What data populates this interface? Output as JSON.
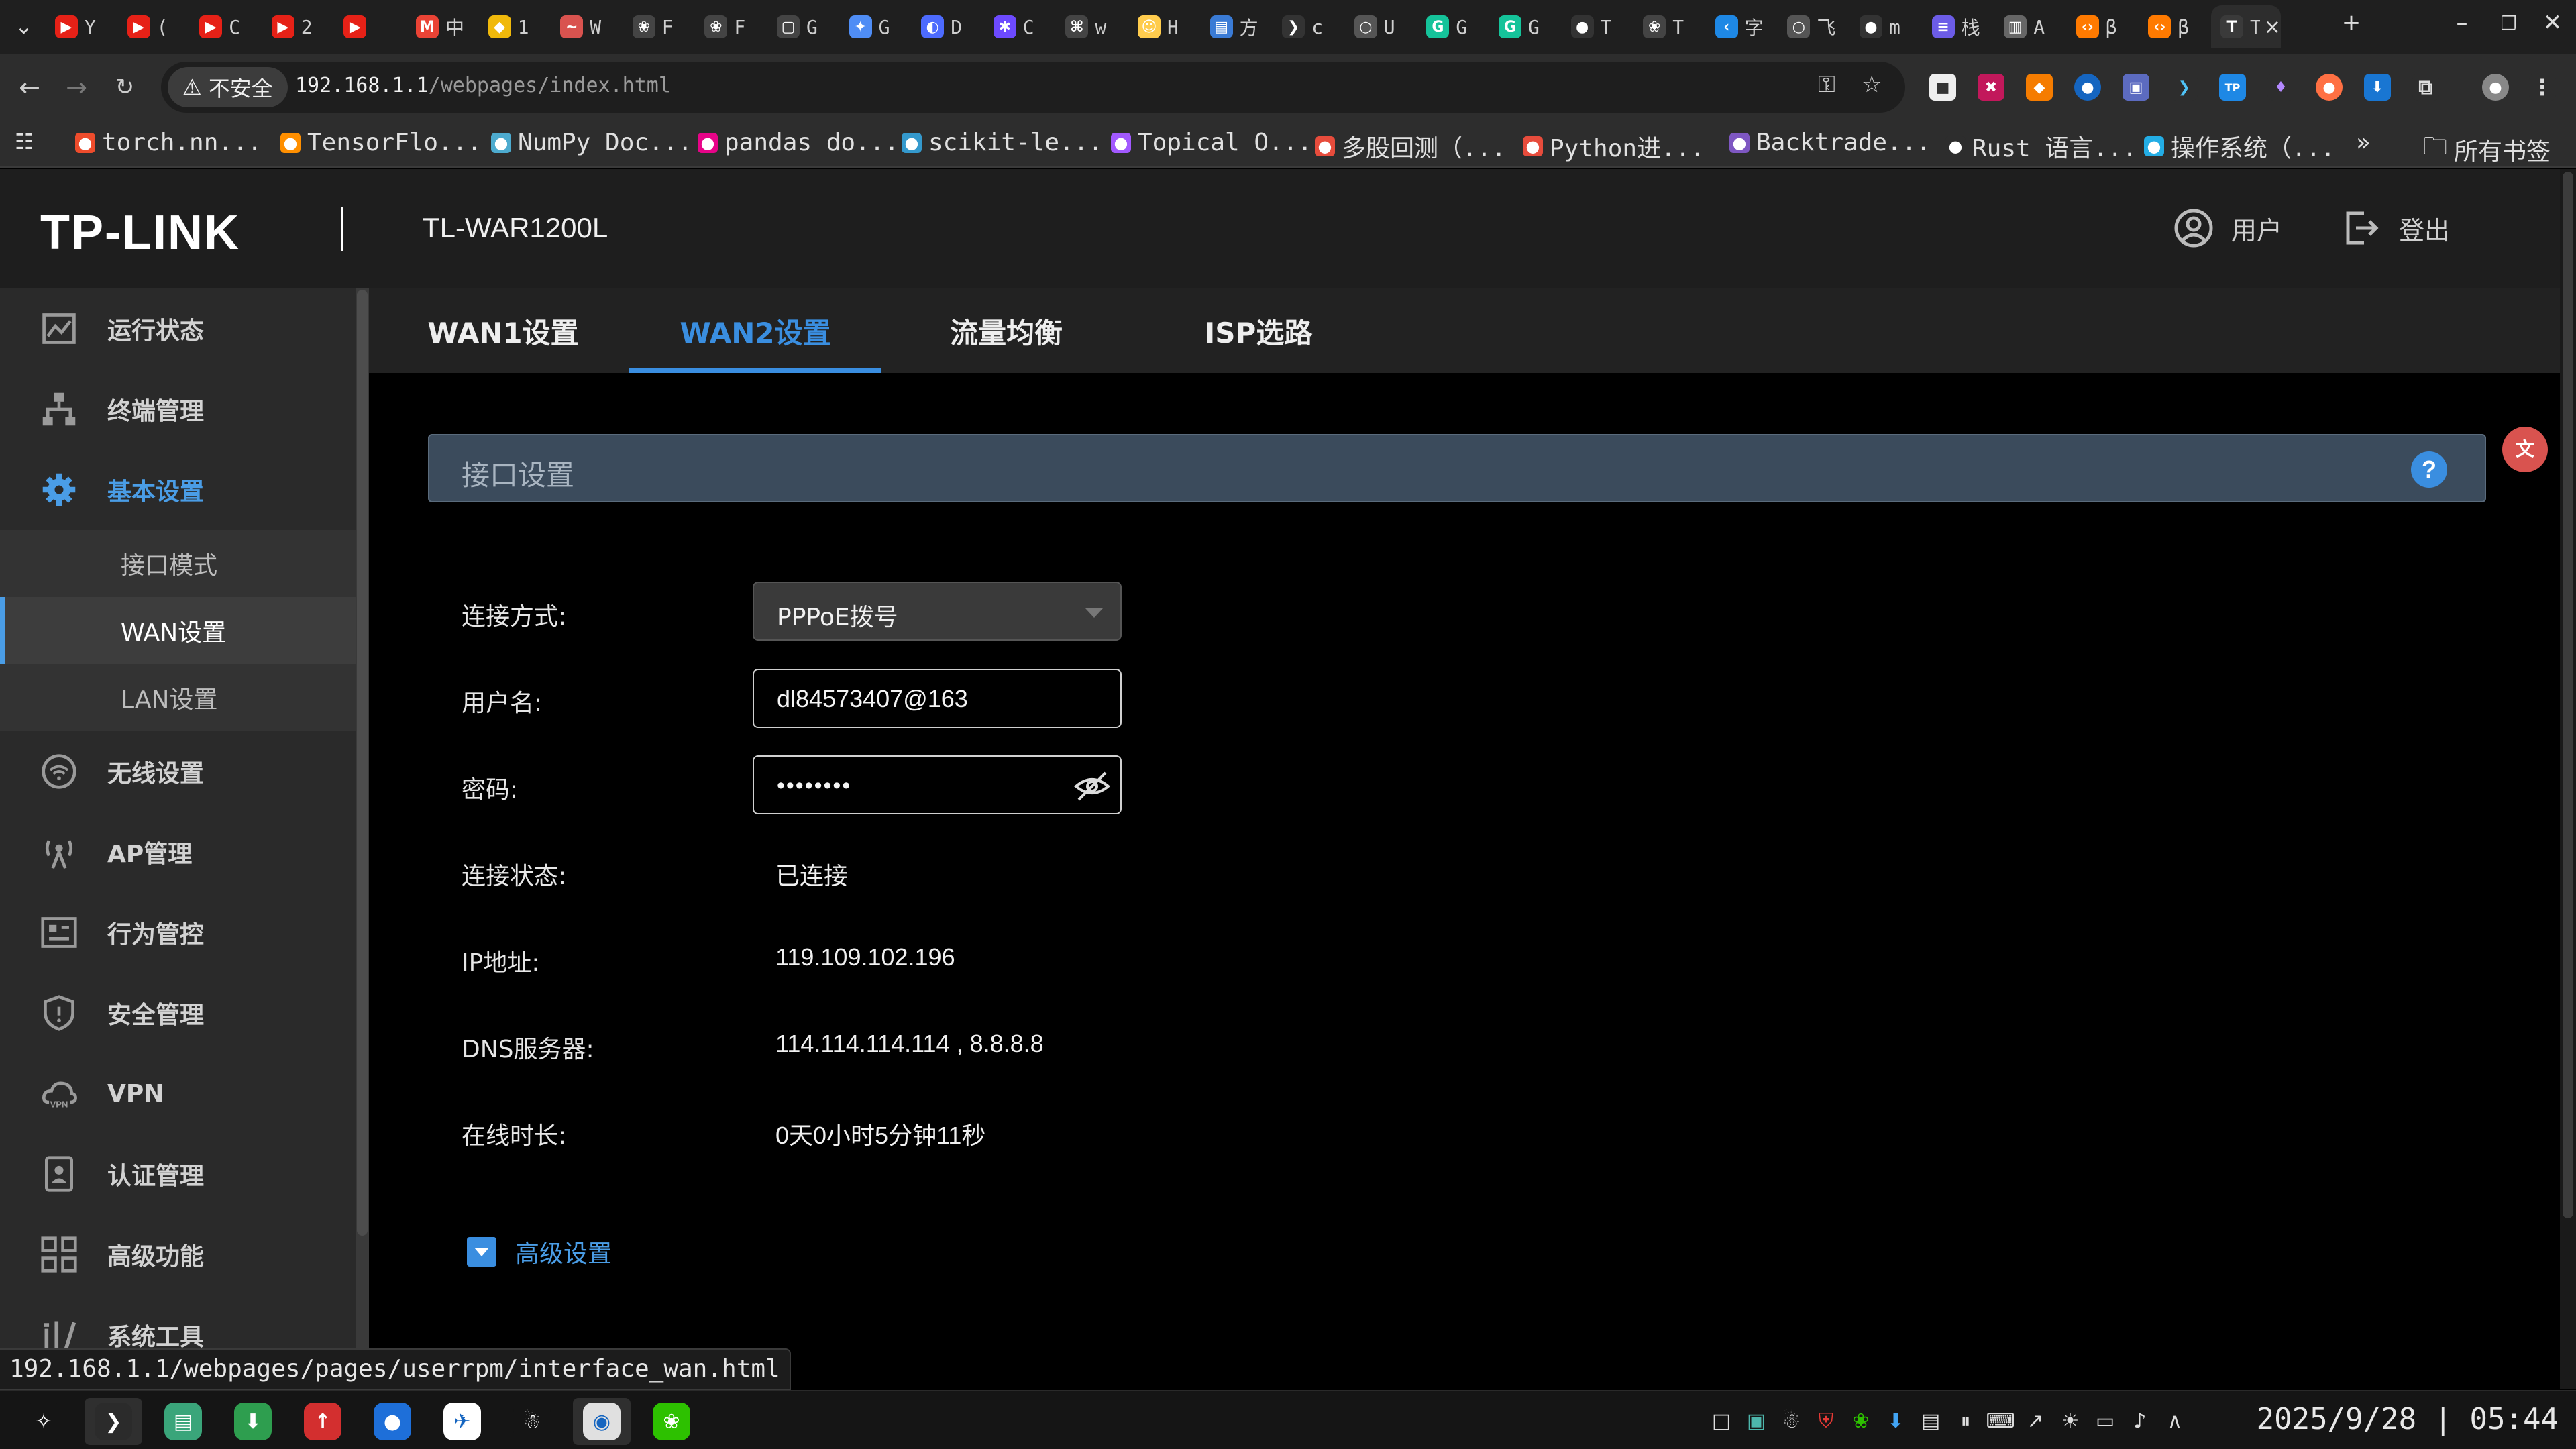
{
  "browser": {
    "tabs": [
      {
        "title": "Y",
        "icon": "youtube-icon",
        "color": "#e62117"
      },
      {
        "title": "(",
        "icon": "youtube-icon",
        "color": "#e62117"
      },
      {
        "title": "C",
        "icon": "youtube-icon",
        "color": "#e62117"
      },
      {
        "title": "2",
        "icon": "youtube-icon",
        "color": "#e62117"
      },
      {
        "title": "",
        "icon": "youtube-icon",
        "color": "#e62117"
      },
      {
        "title": "中",
        "icon": "gmail-icon",
        "color": "#ea4335"
      },
      {
        "title": "1",
        "icon": "binance-icon",
        "color": "#f0b90b"
      },
      {
        "title": "W",
        "icon": "wave-icon",
        "color": "#d9534f"
      },
      {
        "title": "F",
        "icon": "openai-icon",
        "color": "#444444"
      },
      {
        "title": "F",
        "icon": "openai-icon",
        "color": "#444444"
      },
      {
        "title": "G",
        "icon": "github-copilot-icon",
        "color": "#444444"
      },
      {
        "title": "G",
        "icon": "gemini-icon",
        "color": "#4f8df5"
      },
      {
        "title": "D",
        "icon": "deepseek-icon",
        "color": "#4d6bfe"
      },
      {
        "title": "C",
        "icon": "claude-icon",
        "color": "#6d4aff"
      },
      {
        "title": "w",
        "icon": "grok-icon",
        "color": "#444444"
      },
      {
        "title": "H",
        "icon": "huggingface-icon",
        "color": "#ffcc4d"
      },
      {
        "title": "方",
        "icon": "kimi-icon",
        "color": "#3a7bd5"
      },
      {
        "title": "c",
        "icon": "terminal-icon",
        "color": "#333333"
      },
      {
        "title": "U",
        "icon": "globe-icon",
        "color": "#555555"
      },
      {
        "title": "G",
        "icon": "grammarly-icon",
        "color": "#15c39a"
      },
      {
        "title": "G",
        "icon": "grammarly-icon",
        "color": "#15c39a"
      },
      {
        "title": "T",
        "icon": "github-icon",
        "color": "#333333"
      },
      {
        "title": "T",
        "icon": "openai-icon",
        "color": "#444444"
      },
      {
        "title": "字",
        "icon": "vscode-icon",
        "color": "#1e88e5"
      },
      {
        "title": "飞",
        "icon": "globe-icon",
        "color": "#555555"
      },
      {
        "title": "m",
        "icon": "github-icon",
        "color": "#333333"
      },
      {
        "title": "栈",
        "icon": "leetcode-icon",
        "color": "#6c5ce7"
      },
      {
        "title": "A",
        "icon": "book-icon",
        "color": "#666666"
      },
      {
        "title": "β",
        "icon": "code-icon",
        "color": "#ff7a00"
      },
      {
        "title": "β",
        "icon": "code-icon",
        "color": "#ff7a00"
      },
      {
        "title": "T",
        "icon": "tplink-icon",
        "color": "#3a3a3a",
        "active": true
      }
    ],
    "tab_close": "×",
    "new_tab": "+",
    "window_controls": [
      "–",
      "❐",
      "✕"
    ],
    "insecure_label": "不安全",
    "url_host": "192.168.1.1",
    "url_path": "/webpages/index.html",
    "bookmarks": [
      {
        "label": "torch.nn...",
        "icon": "pytorch-icon",
        "color": "#ee4c2c"
      },
      {
        "label": "TensorFlo...",
        "icon": "tensorflow-icon",
        "color": "#ff8f00"
      },
      {
        "label": "NumPy Doc...",
        "icon": "numpy-icon",
        "color": "#4dabcf"
      },
      {
        "label": "pandas do...",
        "icon": "pandas-icon",
        "color": "#e70488"
      },
      {
        "label": "scikit-le...",
        "icon": "sklearn-icon",
        "color": "#3499cd"
      },
      {
        "label": "Topical O...",
        "icon": "topical-icon",
        "color": "#a259ff"
      },
      {
        "label": "多股回测（...",
        "icon": "c-icon",
        "color": "#e74c3c"
      },
      {
        "label": "Python进...",
        "icon": "flame-icon",
        "color": "#e74c3c"
      },
      {
        "label": "Backtrade...",
        "icon": "backtrader-icon",
        "color": "#7e57c2"
      },
      {
        "label": "Rust 语言...",
        "icon": "rust-icon",
        "color": "#2d2d2d"
      },
      {
        "label": "操作系统（...",
        "icon": "bilibili-icon",
        "color": "#23ade5"
      }
    ],
    "bookmarks_overflow": "»",
    "all_bookmarks": "所有书签"
  },
  "router": {
    "brand": "TP-LINK",
    "model": "TL-WAR1200L",
    "user_label": "用户",
    "logout_label": "登出",
    "nav": [
      {
        "label": "运行状态",
        "icon": "status-chart-icon"
      },
      {
        "label": "终端管理",
        "icon": "network-tree-icon"
      },
      {
        "label": "基本设置",
        "icon": "gear-icon",
        "active": true
      },
      {
        "label": "无线设置",
        "icon": "wifi-icon"
      },
      {
        "label": "AP管理",
        "icon": "antenna-icon"
      },
      {
        "label": "行为管控",
        "icon": "behavior-icon"
      },
      {
        "label": "安全管理",
        "icon": "shield-icon"
      },
      {
        "label": "VPN",
        "icon": "vpn-cloud-icon"
      },
      {
        "label": "认证管理",
        "icon": "id-card-icon"
      },
      {
        "label": "高级功能",
        "icon": "grid-icon"
      },
      {
        "label": "系统工具",
        "icon": "tools-icon"
      }
    ],
    "subnav": [
      {
        "label": "接口模式"
      },
      {
        "label": "WAN设置",
        "current": true
      },
      {
        "label": "LAN设置"
      }
    ],
    "tabs": [
      {
        "label": "WAN1设置"
      },
      {
        "label": "WAN2设置",
        "active": true
      },
      {
        "label": "流量均衡"
      },
      {
        "label": "ISP选路"
      }
    ],
    "section_title": "接口设置",
    "help": "?",
    "form": {
      "connection_type_label": "连接方式:",
      "connection_type_value": "PPPoE拨号",
      "username_label": "用户名:",
      "username_value": "dl84573407@163",
      "password_label": "密码:",
      "password_mask": "••••••••",
      "status_label": "连接状态:",
      "status_value": "已连接",
      "ip_label": "IP地址:",
      "ip_value": "119.109.102.196",
      "dns_label": "DNS服务器:",
      "dns_value": "114.114.114.114 , 8.8.8.8",
      "uptime_label": "在线时长:",
      "uptime_value": "0天0小时5分钟11秒"
    },
    "advanced_label": "高级设置",
    "accent": "#3a8ee0"
  },
  "status_url": "192.168.1.1/webpages/pages/userrpm/interface_wan.html",
  "taskbar": {
    "apps": [
      {
        "icon": "launcher-icon"
      },
      {
        "icon": "terminal-icon",
        "open": true
      },
      {
        "icon": "file-manager-icon"
      },
      {
        "icon": "download-manager-icon"
      },
      {
        "icon": "stock-app-icon"
      },
      {
        "icon": "browser-icon"
      },
      {
        "icon": "feishu-icon"
      },
      {
        "icon": "qq-icon"
      },
      {
        "icon": "chrome-icon",
        "open": true
      },
      {
        "icon": "wechat-icon"
      }
    ],
    "tray": [
      "desktop-icon",
      "screen-icon",
      "qq-icon",
      "security-icon",
      "wechat-icon",
      "download-icon",
      "clipboard-icon",
      "pause-icon",
      "keyboard-icon",
      "rocket-icon",
      "brightness-icon",
      "display-icon",
      "volume-icon",
      "chevron-up-icon"
    ],
    "clock": "2025/9/28 | 05:44"
  }
}
